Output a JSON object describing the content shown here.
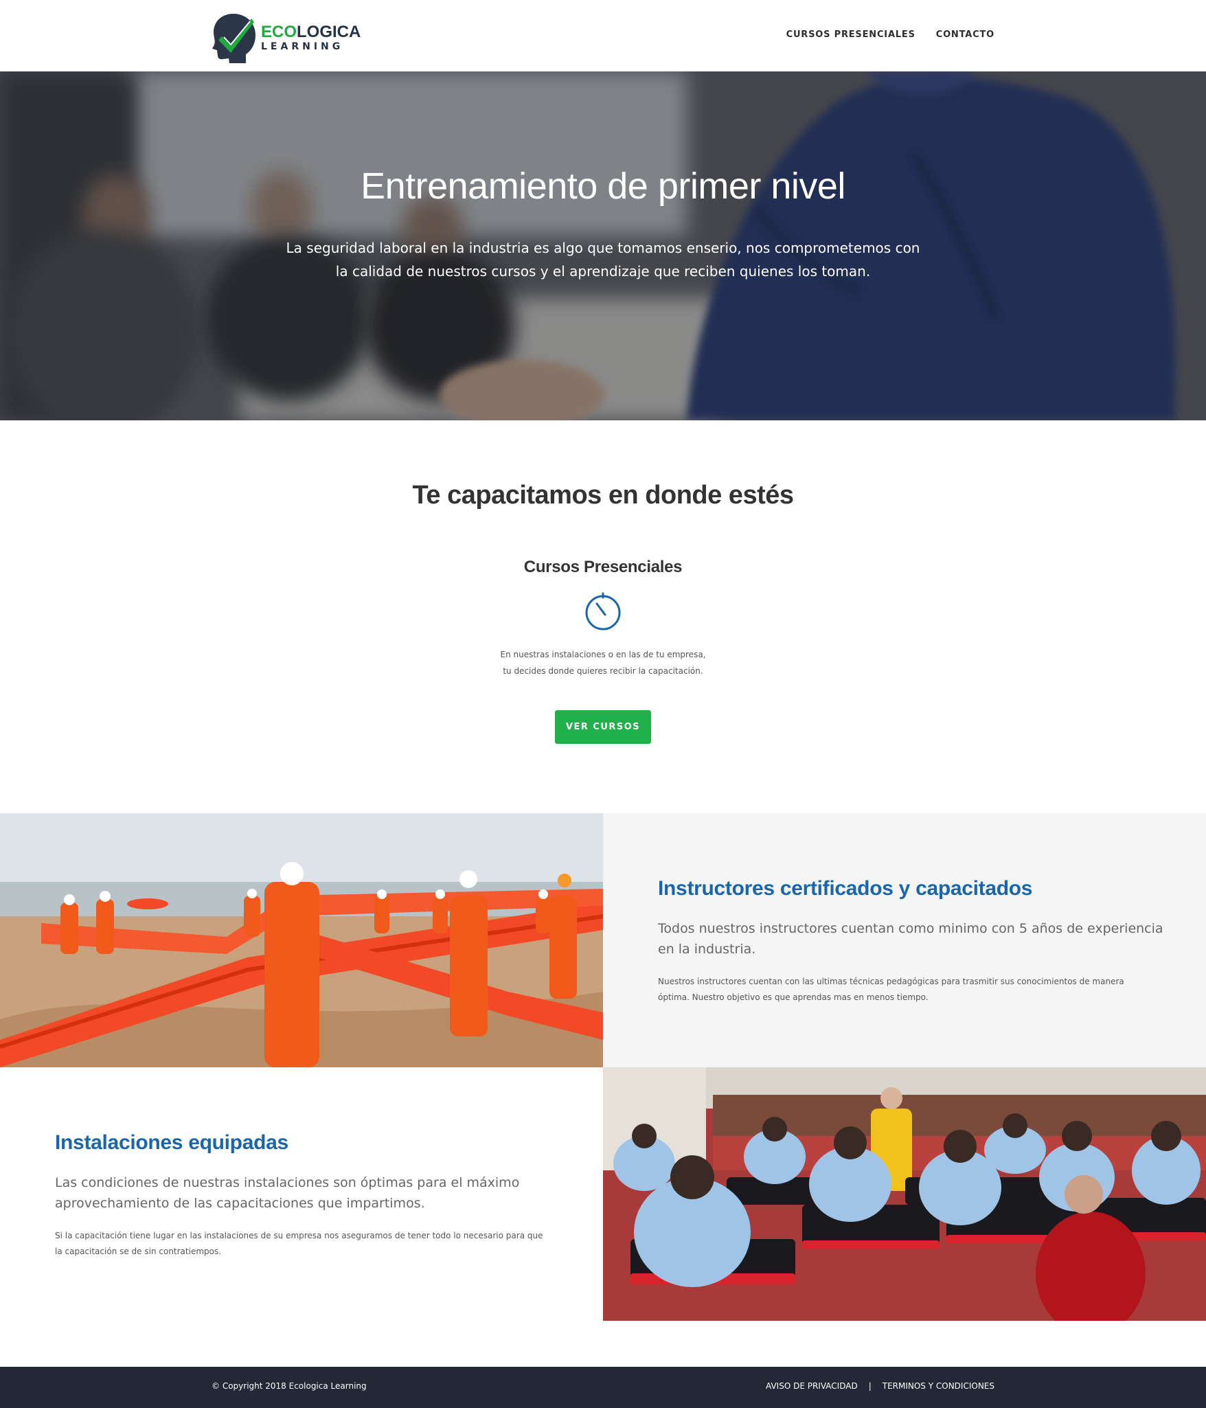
{
  "header": {
    "logo_top": "ECO",
    "logo_top_rest": "LOGICA",
    "logo_bottom": "LEARNING",
    "nav": [
      {
        "label": "CURSOS PRESENCIALES"
      },
      {
        "label": "CONTACTO"
      }
    ]
  },
  "hero": {
    "title": "Entrenamiento de primer nivel",
    "subtitle_line1": "La seguridad laboral en la industria es algo que tomamos enserio, nos comprometemos con",
    "subtitle_line2": "la calidad de nuestros cursos y el aprendizaje que reciben quienes los toman."
  },
  "courses": {
    "section_title": "Te capacitamos en donde estés",
    "card_title": "Cursos Presenciales",
    "icon": "stopwatch-icon",
    "text_line1": "En nuestras instalaciones o en las de tu empresa,",
    "text_line2": "tu decides donde quieres recibir la capacitación.",
    "button_label": "VER CURSOS"
  },
  "instructors": {
    "title": "Instructores certificados y capacitados",
    "lead_line1": "Todos nuestros instructores cuentan como minimo con 5 años de experiencia",
    "lead_line2": "en la industria.",
    "body_line1": "Nuestros instructores cuentan con las ultimas técnicas pedagógicas para trasmitir sus conocimientos de manera",
    "body_line2": "óptima. Nuestro objetivo es que aprendas mas en menos tiempo."
  },
  "facilities": {
    "title": "Instalaciones equipadas",
    "lead_line1": "Las condiciones de nuestras instalaciones son óptimas para el máximo",
    "lead_line2": "aprovechamiento de las capacitaciones que impartimos.",
    "body_line1": "Si la capacitación tiene lugar en las instalaciones de su empresa nos aseguramos de tener todo lo necesario para que",
    "body_line2": "la capacitación se de sin contratiempos."
  },
  "footer": {
    "copyright": "© Copyright 2018 Ecologica Learning",
    "link_privacy": "AVISO DE PRIVACIDAD",
    "separator": "|",
    "link_terms": "TERMINOS Y CONDICIONES"
  },
  "colors": {
    "brand_green": "#21b14b",
    "brand_blue": "#1a66a8",
    "footer_bg": "#222836"
  }
}
